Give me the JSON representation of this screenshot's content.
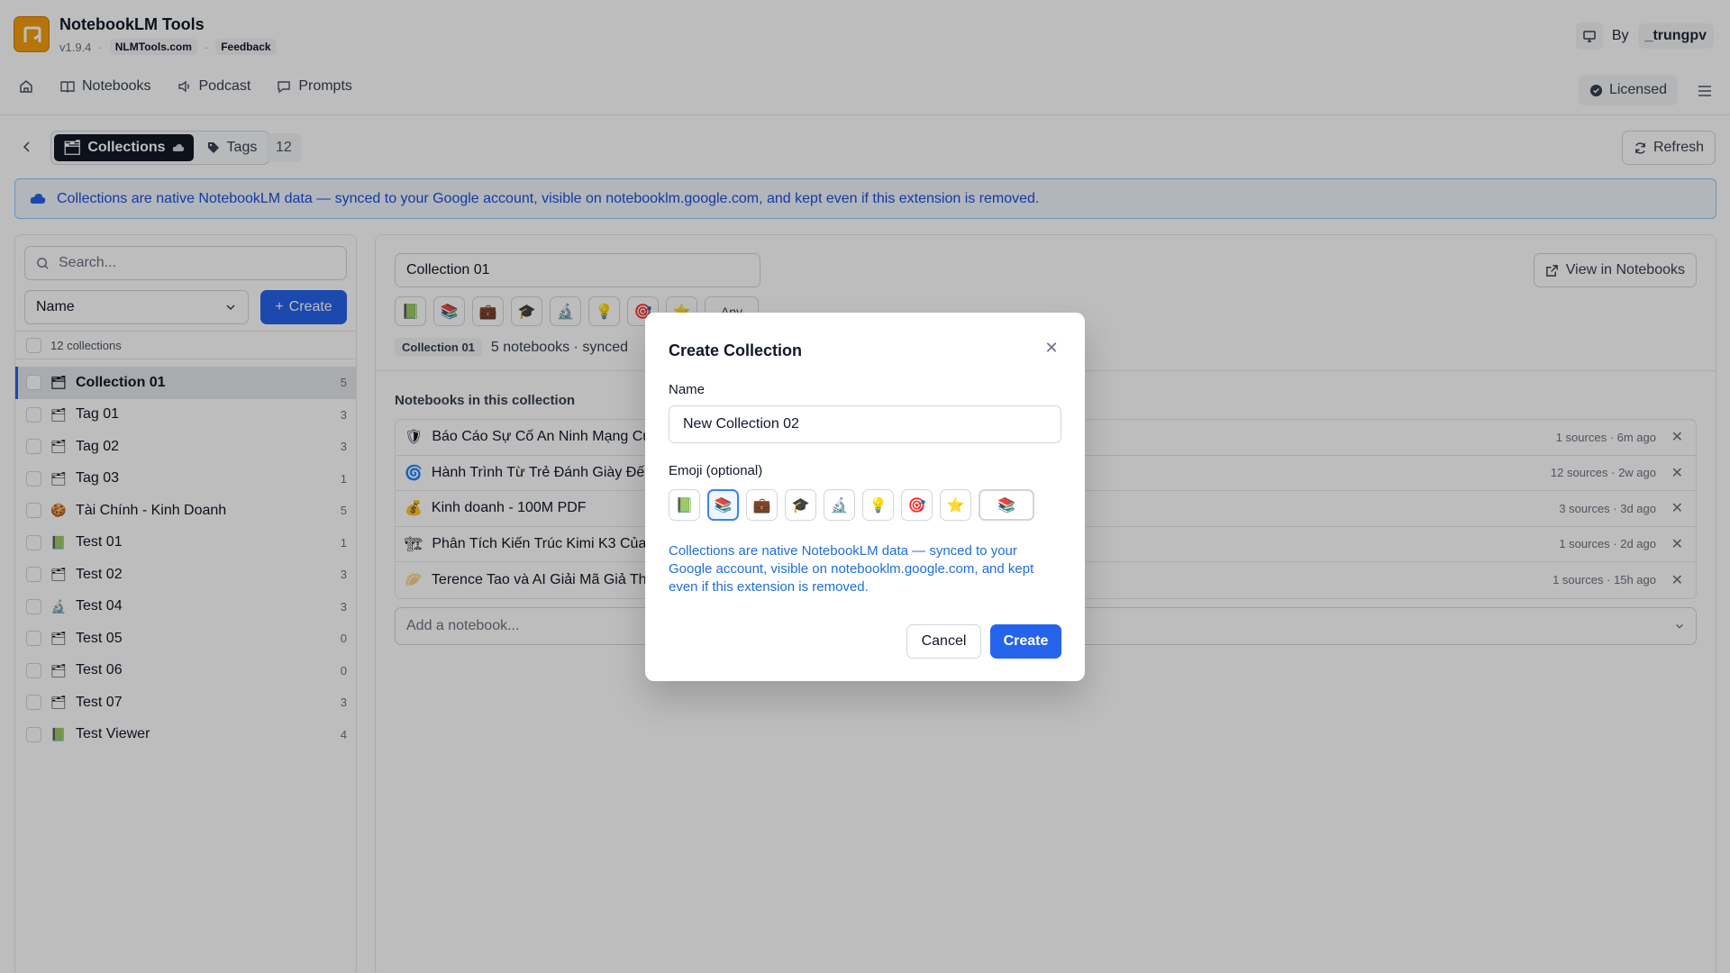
{
  "app": {
    "title": "NotebookLM Tools",
    "version": "v1.9.4",
    "site": "NLMTools.com",
    "feedback": "Feedback",
    "by_label": "By",
    "author": "_trungpv"
  },
  "nav": {
    "notebooks": "Notebooks",
    "podcast": "Podcast",
    "prompts": "Prompts",
    "licensed": "Licensed"
  },
  "toolbar": {
    "collections_tab": "Collections",
    "tags_tab": "Tags",
    "count": "12",
    "refresh": "Refresh"
  },
  "banner": {
    "text": "Collections are native NotebookLM data — synced to your Google account, visible on notebooklm.google.com, and kept even if this extension is removed."
  },
  "sidebar": {
    "search_placeholder": "Search...",
    "sort_value": "Name",
    "create_label": "Create",
    "select_all_label": "12 collections",
    "items": [
      {
        "emoji": "🗂",
        "label": "Collection 01",
        "count": "5"
      },
      {
        "emoji": "🗂",
        "label": "Tag 01",
        "count": "3"
      },
      {
        "emoji": "🗂",
        "label": "Tag 02",
        "count": "3"
      },
      {
        "emoji": "🗂",
        "label": "Tag 03",
        "count": "1"
      },
      {
        "emoji": "🍪",
        "label": "Tài Chính - Kinh Doanh",
        "count": "5"
      },
      {
        "emoji": "📗",
        "label": "Test 01",
        "count": "1"
      },
      {
        "emoji": "🗂",
        "label": "Test 02",
        "count": "3"
      },
      {
        "emoji": "🔬",
        "label": "Test 04",
        "count": "3"
      },
      {
        "emoji": "🗂",
        "label": "Test 05",
        "count": "0"
      },
      {
        "emoji": "🗂",
        "label": "Test 06",
        "count": "0"
      },
      {
        "emoji": "🗂",
        "label": "Test 07",
        "count": "3"
      },
      {
        "emoji": "📗",
        "label": "Test Viewer",
        "count": "4"
      }
    ]
  },
  "detail": {
    "name_value": "Collection 01",
    "emojis": [
      "📗",
      "📚",
      "💼",
      "🎓",
      "🔬",
      "💡",
      "🎯",
      "⭐"
    ],
    "any_label": "Any",
    "tag_label": "Collection 01",
    "meta_text": "5 notebooks · synced",
    "view_label": "View in Notebooks",
    "section_title": "Notebooks in this collection",
    "notebooks": [
      {
        "emoji": "🛡",
        "title": "Báo Cáo Sự Cố An Ninh Mạng Của",
        "meta": "1 sources · 6m ago"
      },
      {
        "emoji": "🌀",
        "title": "Hành Trình Từ Trẻ Đánh Giày Đến",
        "meta": "12 sources · 2w ago"
      },
      {
        "emoji": "💰",
        "title": "Kinh doanh - 100M PDF",
        "meta": "3 sources · 3d ago"
      },
      {
        "emoji": "🏗",
        "title": "Phân Tích Kiến Trúc Kimi K3 Của S",
        "meta": "1 sources · 2d ago"
      },
      {
        "emoji": "🥟",
        "title": "Terence Tao và AI Giải Mã Giả Thu",
        "meta": "1 sources · 15h ago"
      }
    ],
    "add_placeholder": "Add a notebook..."
  },
  "modal": {
    "title": "Create Collection",
    "name_label": "Name",
    "name_value": "New Collection 02",
    "emoji_label": "Emoji (optional)",
    "emojis": [
      "📗",
      "📚",
      "💼",
      "🎓",
      "🔬",
      "💡",
      "🎯",
      "⭐"
    ],
    "custom_emoji": "📚",
    "note": "Collections are native NotebookLM data — synced to your Google account, visible on notebooklm.google.com, and kept even if this extension is removed.",
    "cancel": "Cancel",
    "create": "Create"
  }
}
